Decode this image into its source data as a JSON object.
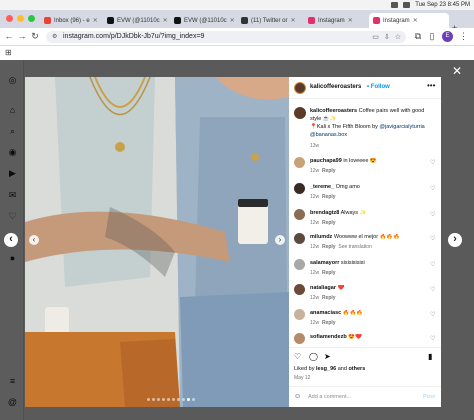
{
  "menubar": {
    "datetime": "Tue Sep 23  8:45 PM"
  },
  "tabs": [
    {
      "title": "Inbox (96) - e",
      "fav_color": "#ea4335",
      "active": false
    },
    {
      "title": "EVW (@11010c",
      "fav_color": "#111111",
      "active": false
    },
    {
      "title": "EVW (@11010c",
      "fav_color": "#111111",
      "active": false
    },
    {
      "title": "(11) Twitter or",
      "fav_color": "#333333",
      "active": false
    },
    {
      "title": "Instagram",
      "fav_color": "#e1306c",
      "active": false
    },
    {
      "title": "Instagram",
      "fav_color": "#e1306c",
      "active": true
    }
  ],
  "address": {
    "url": "instagram.com/p/DJkDbk-Jb7u/?img_index=9"
  },
  "profile_initial": "E",
  "post": {
    "username": "kalicoffeeroasters",
    "follow": "Follow",
    "caption_user": "kalicoffeeroasters",
    "caption_line1": "Coffee pairs well with good style ☕️✨",
    "caption_line2": "📍Kali x The Fifth Bloom by ",
    "caption_mention1": "@javigarcialyturria",
    "caption_mention2": "@bananas.box",
    "caption_time": "13w",
    "comments": [
      {
        "user": "pauchapa99",
        "text": "in loveeee 😍",
        "time": "12w",
        "reply": "Reply",
        "extra": "",
        "color": "#c9a27a"
      },
      {
        "user": "_tereme_",
        "text": "Omg amo",
        "time": "12w",
        "reply": "Reply",
        "extra": "",
        "color": "#3b2a22"
      },
      {
        "user": "brendagtz8",
        "text": "Always ✨",
        "time": "12w",
        "reply": "Reply",
        "extra": "",
        "color": "#8c6b54"
      },
      {
        "user": "milumdz",
        "text": "Woowww el mejor 🔥🔥🔥",
        "time": "12w",
        "reply": "Reply",
        "extra": "See translation",
        "color": "#5d4a3f"
      },
      {
        "user": "salamayorr",
        "text": "sisisisisisi",
        "time": "12w",
        "reply": "Reply",
        "extra": "",
        "color": "#a8a8a8"
      },
      {
        "user": "nataliagar",
        "text": "❤️",
        "time": "12w",
        "reply": "Reply",
        "extra": "",
        "color": "#6b4a3a"
      },
      {
        "user": "anamaciasc",
        "text": "🔥🔥🔥",
        "time": "12w",
        "reply": "Reply",
        "extra": "",
        "color": "#c7b29c"
      },
      {
        "user": "sofiamendezb",
        "text": "😍❤️",
        "time": "",
        "reply": "",
        "extra": "",
        "color": "#b58b6a"
      }
    ],
    "liked_by_prefix": "Liked by ",
    "liked_by_user": "lesg_96",
    "liked_by_and": " and ",
    "liked_by_others": "others",
    "date": "May 12",
    "add_comment_placeholder": "Add a comment...",
    "post_label": "Post"
  },
  "colors": {
    "ig_blue": "#0095f6",
    "link_blue": "#00376b"
  },
  "icons": [
    "instagram-icon",
    "home-icon",
    "search-icon",
    "explore-icon",
    "reels-icon",
    "messenger-icon",
    "heart-icon",
    "create-icon",
    "menu-icon",
    "threads-icon"
  ]
}
